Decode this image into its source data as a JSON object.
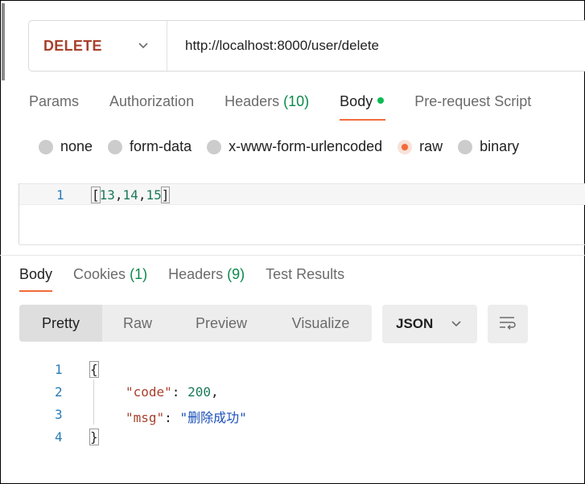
{
  "request": {
    "method": "DELETE",
    "url": "http://localhost:8000/user/delete"
  },
  "request_tabs": [
    {
      "label": "Params",
      "count": ""
    },
    {
      "label": "Authorization",
      "count": ""
    },
    {
      "label": "Headers",
      "count": "(10)"
    },
    {
      "label": "Body",
      "count": ""
    },
    {
      "label": "Pre-request Script",
      "count": ""
    }
  ],
  "body_types": [
    {
      "label": "none",
      "checked": false
    },
    {
      "label": "form-data",
      "checked": false
    },
    {
      "label": "x-www-form-urlencoded",
      "checked": false
    },
    {
      "label": "raw",
      "checked": true
    },
    {
      "label": "binary",
      "checked": false
    }
  ],
  "request_body": {
    "line_number": "1",
    "open": "[",
    "v1": "13",
    "c1": ",",
    "v2": "14",
    "c2": ",",
    "v3": "15",
    "close": "]"
  },
  "response_tabs": [
    {
      "label": "Body",
      "count": ""
    },
    {
      "label": "Cookies",
      "count": "(1)"
    },
    {
      "label": "Headers",
      "count": "(9)"
    },
    {
      "label": "Test Results",
      "count": ""
    }
  ],
  "view_modes": [
    "Pretty",
    "Raw",
    "Preview",
    "Visualize"
  ],
  "format": "JSON",
  "response_body": {
    "line_numbers": [
      "1",
      "2",
      "3",
      "4"
    ],
    "open": "{",
    "code_key": "\"code\"",
    "code_value": "200",
    "msg_key": "\"msg\"",
    "msg_value": "\"删除成功\"",
    "close": "}",
    "colon": ":",
    "comma": ","
  },
  "icons": {
    "method_dropdown": "chevron-down-icon",
    "format_dropdown": "chevron-down-icon",
    "wrap": "wrap-lines-icon",
    "body_dot": "status-dot-icon"
  },
  "colors": {
    "accent": "#f26b3a",
    "method": "#a8412c",
    "count": "#0a8a4b",
    "dot": "#0cbb52"
  }
}
